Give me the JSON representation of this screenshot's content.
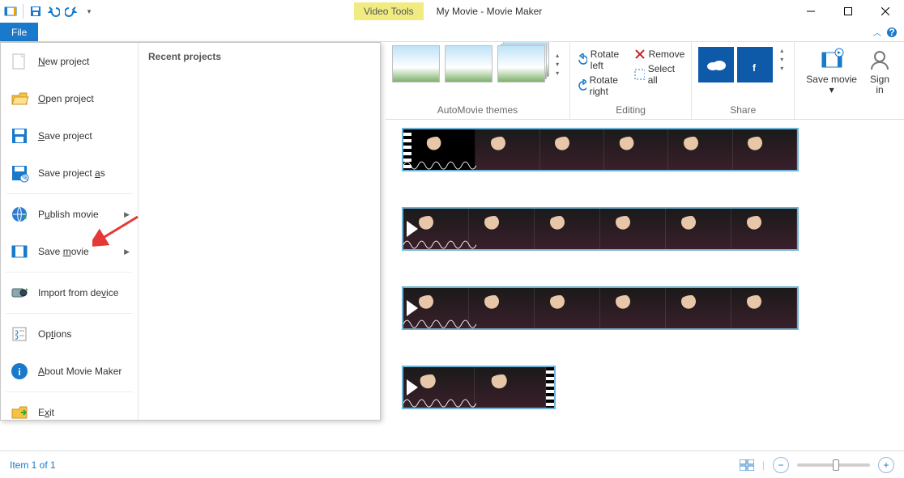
{
  "titlebar": {
    "video_tools": "Video Tools",
    "app_title": "My Movie - Movie Maker"
  },
  "tabs": {
    "file": "File"
  },
  "ribbon": {
    "automovie_label": "AutoMovie themes",
    "editing_label": "Editing",
    "share_label": "Share",
    "rotate_left": "Rotate left",
    "rotate_right": "Rotate right",
    "remove": "Remove",
    "select_all": "Select all",
    "save_movie": "Save movie",
    "sign_in": "Sign in"
  },
  "file_menu": {
    "recent_heading": "Recent projects",
    "items": [
      {
        "label_pre": "",
        "key": "N",
        "label_post": "ew project",
        "icon": "new"
      },
      {
        "label_pre": "",
        "key": "O",
        "label_post": "pen project",
        "icon": "open"
      },
      {
        "label_pre": "",
        "key": "S",
        "label_post": "ave project",
        "icon": "save"
      },
      {
        "label_pre": "Save project ",
        "key": "a",
        "label_post": "s",
        "icon": "saveas"
      },
      {
        "label_pre": "P",
        "key": "u",
        "label_post": "blish movie",
        "icon": "publish",
        "submenu": true
      },
      {
        "label_pre": "Save ",
        "key": "m",
        "label_post": "ovie",
        "icon": "savemovie",
        "submenu": true
      },
      {
        "label_pre": "Import from de",
        "key": "v",
        "label_post": "ice",
        "icon": "import"
      },
      {
        "label_pre": "Op",
        "key": "t",
        "label_post": "ions",
        "icon": "options"
      },
      {
        "label_pre": "",
        "key": "A",
        "label_post": "bout Movie Maker",
        "icon": "about"
      },
      {
        "label_pre": "E",
        "key": "x",
        "label_post": "it",
        "icon": "exit"
      }
    ]
  },
  "status": {
    "left": "Item 1 of 1"
  }
}
